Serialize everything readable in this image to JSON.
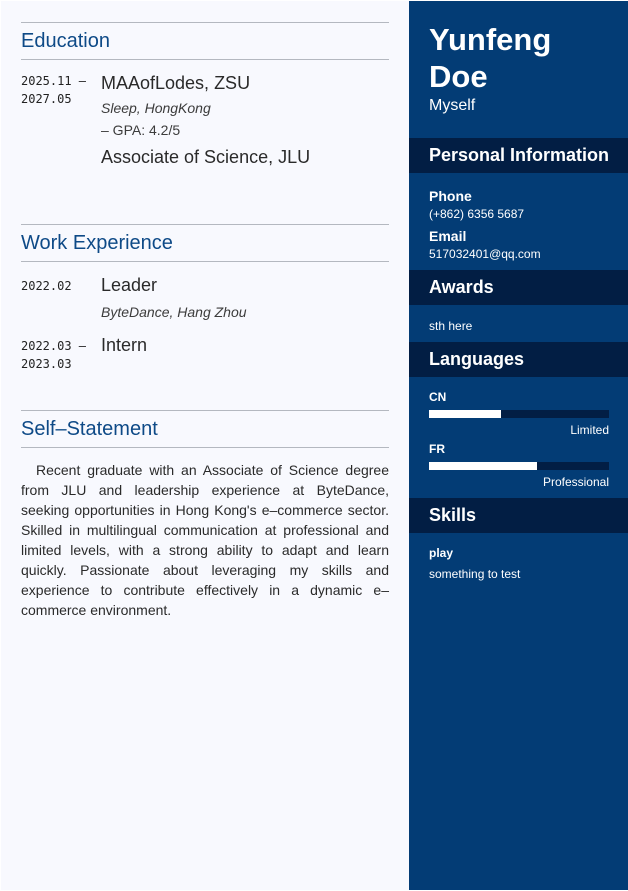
{
  "education": {
    "heading": "Education",
    "entries": [
      {
        "date": "2025.11 –\n2027.05",
        "degree": "MAAofLodes, ZSU",
        "location": "Sleep, HongKong",
        "gpa": "– GPA: 4.2/5"
      },
      {
        "degree": "Associate of Science, JLU"
      }
    ]
  },
  "work": {
    "heading": "Work Experience",
    "entries": [
      {
        "date": "2022.02",
        "role": "Leader",
        "company": "ByteDance, Hang Zhou"
      },
      {
        "date": "2022.03 –\n2023.03",
        "role": "Intern"
      }
    ]
  },
  "statement": {
    "heading": "Self–Statement",
    "text": "Recent graduate with an Associate of Science degree from JLU and leadership experience at ByteDance, seeking opportunities in Hong Kong's e–commerce sector. Skilled in multilingual communication at professional and limited levels, with a strong ability to adapt and learn quickly. Passionate about leveraging my skills and experience to contribute effectively in a dynamic e–commerce environment."
  },
  "profile": {
    "first_name": "Yunfeng",
    "last_name": "Doe",
    "tagline": "Myself"
  },
  "personal": {
    "heading": "Personal Information",
    "phone_label": "Phone",
    "phone": "(+862) 6356 5687",
    "email_label": "Email",
    "email": "517032401@qq.com"
  },
  "awards": {
    "heading": "Awards",
    "text": "sth here"
  },
  "languages": {
    "heading": "Languages",
    "items": [
      {
        "code": "CN",
        "level": "Limited",
        "proficiency": 0.4
      },
      {
        "code": "FR",
        "level": "Professional",
        "proficiency": 0.6
      }
    ]
  },
  "skills": {
    "heading": "Skills",
    "name": "play",
    "description": "something to test"
  },
  "colors": {
    "sidebar": "#033c75",
    "sidebar_header": "#021e44",
    "heading": "#0e4a87",
    "left_background": "#f8f9fe"
  }
}
